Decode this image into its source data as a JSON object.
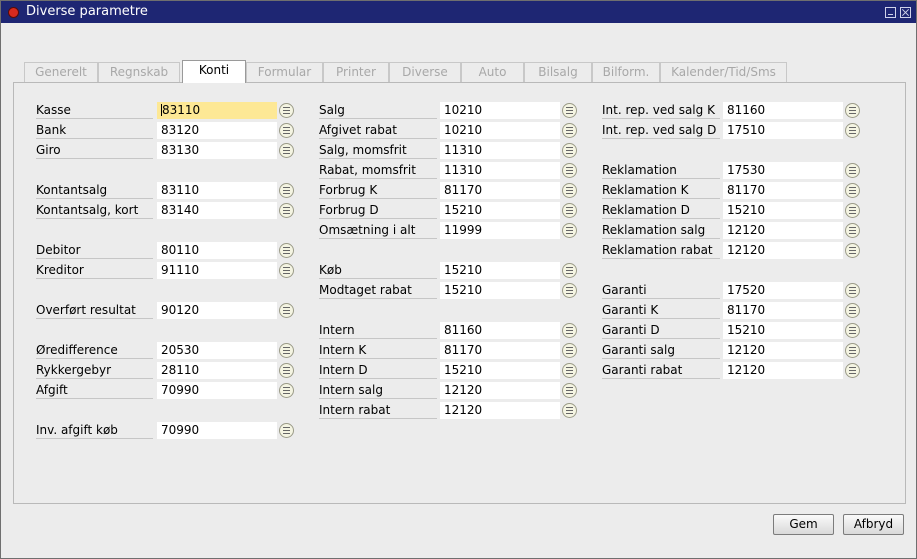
{
  "window": {
    "title": "Diverse parametre"
  },
  "tabs": [
    "Generelt",
    "Regnskab",
    "Konti",
    "Formular",
    "Printer",
    "Diverse",
    "Auto",
    "Bilsalg",
    "Bilform.",
    "Kalender/Tid/Sms"
  ],
  "active_tab": "Konti",
  "col1": [
    {
      "label": "Kasse",
      "value": "83110"
    },
    {
      "label": "Bank",
      "value": "83120"
    },
    {
      "label": "Giro",
      "value": "83130"
    },
    {
      "label": "Kontantsalg",
      "value": "83110"
    },
    {
      "label": "Kontantsalg, kort",
      "value": "83140"
    },
    {
      "label": "Debitor",
      "value": "80110"
    },
    {
      "label": "Kreditor",
      "value": "91110"
    },
    {
      "label": "Overført resultat",
      "value": "90120"
    },
    {
      "label": "Øredifference",
      "value": "20530"
    },
    {
      "label": "Rykkergebyr",
      "value": "28110"
    },
    {
      "label": "Afgift",
      "value": "70990"
    },
    {
      "label": "Inv. afgift køb",
      "value": "70990"
    }
  ],
  "col2": [
    {
      "label": "Salg",
      "value": "10210"
    },
    {
      "label": "Afgivet rabat",
      "value": "10210"
    },
    {
      "label": "Salg, momsfrit",
      "value": "11310"
    },
    {
      "label": "Rabat, momsfrit",
      "value": "11310"
    },
    {
      "label": "Forbrug K",
      "value": "81170"
    },
    {
      "label": "Forbrug D",
      "value": "15210"
    },
    {
      "label": "Omsætning i alt",
      "value": "11999"
    },
    {
      "label": "Køb",
      "value": "15210"
    },
    {
      "label": "Modtaget rabat",
      "value": "15210"
    },
    {
      "label": "Intern",
      "value": "81160"
    },
    {
      "label": "Intern K",
      "value": "81170"
    },
    {
      "label": "Intern D",
      "value": "15210"
    },
    {
      "label": "Intern salg",
      "value": "12120"
    },
    {
      "label": "Intern rabat",
      "value": "12120"
    }
  ],
  "col3": [
    {
      "label": "Int. rep. ved salg K",
      "value": "81160"
    },
    {
      "label": "Int. rep. ved salg D",
      "value": "17510"
    },
    {
      "label": "Reklamation",
      "value": "17530"
    },
    {
      "label": "Reklamation K",
      "value": "81170"
    },
    {
      "label": "Reklamation D",
      "value": "15210"
    },
    {
      "label": "Reklamation salg",
      "value": "12120"
    },
    {
      "label": "Reklamation rabat",
      "value": "12120"
    },
    {
      "label": "Garanti",
      "value": "17520"
    },
    {
      "label": "Garanti K",
      "value": "81170"
    },
    {
      "label": "Garanti D",
      "value": "15210"
    },
    {
      "label": "Garanti salg",
      "value": "12120"
    },
    {
      "label": "Garanti rabat",
      "value": "12120"
    }
  ],
  "buttons": {
    "save": "Gem",
    "cancel": "Afbryd"
  },
  "icons": {
    "lookup": "lookup-list-icon",
    "close": "close-icon",
    "minimize": "minimize-icon"
  },
  "colors": {
    "titlebar": "#1e2673",
    "focused_field": "#fde895"
  }
}
